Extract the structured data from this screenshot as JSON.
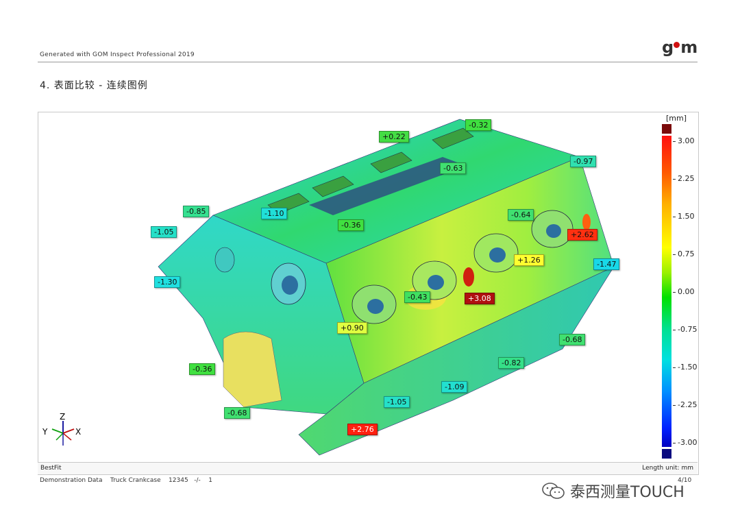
{
  "header": {
    "generated": "Generated with GOM Inspect Professional 2019",
    "logo": "gom"
  },
  "section_title": "4. 表面比较 - 连续图例",
  "legend": {
    "unit": "[mm]",
    "ticks": [
      "3.00",
      "2.25",
      "1.50",
      "0.75",
      "0.00",
      "-0.75",
      "-1.50",
      "-2.25",
      "-3.00"
    ],
    "colors": {
      "over": "#7b0a0a",
      "under": "#0a0a80"
    }
  },
  "callouts": [
    {
      "label": "-0.32",
      "color": "#3fe040"
    },
    {
      "label": "+0.22",
      "color": "#44dd44"
    },
    {
      "label": "-0.63",
      "color": "#40e070"
    },
    {
      "label": "-0.97",
      "color": "#30e0b0"
    },
    {
      "label": "-0.85",
      "color": "#35e090"
    },
    {
      "label": "-1.10",
      "color": "#20e0d8"
    },
    {
      "label": "-0.36",
      "color": "#40e040"
    },
    {
      "label": "-0.64",
      "color": "#40e070"
    },
    {
      "label": "-1.05",
      "color": "#25e0c8"
    },
    {
      "label": "+2.62",
      "color": "#ff3010"
    },
    {
      "label": "+1.26",
      "color": "#ffff30"
    },
    {
      "label": "-1.47",
      "color": "#18d8e8"
    },
    {
      "label": "-1.30",
      "color": "#20e0e0"
    },
    {
      "label": "-0.43",
      "color": "#40e060"
    },
    {
      "label": "+3.08",
      "color": "#b01010"
    },
    {
      "label": "+0.90",
      "color": "#e0ff40"
    },
    {
      "label": "-0.68",
      "color": "#40e070"
    },
    {
      "label": "-0.82",
      "color": "#35e088"
    },
    {
      "label": "-0.36",
      "color": "#40e040"
    },
    {
      "label": "-1.09",
      "color": "#22e0d0"
    },
    {
      "label": "-1.05",
      "color": "#25e0c8"
    },
    {
      "label": "-0.68",
      "color": "#40e070"
    },
    {
      "label": "+2.76",
      "color": "#ff2010"
    }
  ],
  "axes": {
    "z": "Z",
    "y": "Y",
    "x": "X"
  },
  "bottom_bar": {
    "method": "BestFit",
    "unit_note": "Length unit: mm"
  },
  "footer": {
    "info": "Demonstration Data    Truck Crankcase    12345   -/-    1",
    "page": "4/10"
  },
  "watermark": "泰西测量TOUCH"
}
